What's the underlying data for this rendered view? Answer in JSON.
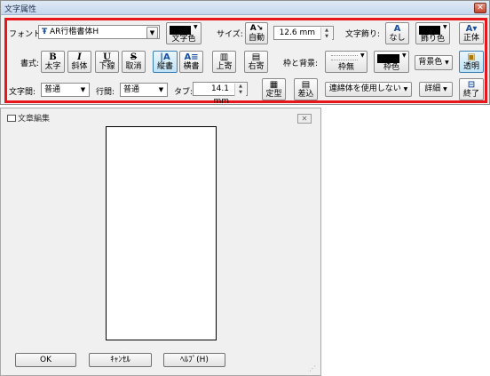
{
  "toolbar_window": {
    "title": "文字属性",
    "close": "✕",
    "font_label": "フォント:",
    "font_icon": "Ŧ",
    "font_value": "AR行楷書体H",
    "text_color_caption": "文字色",
    "size_label": "サイズ:",
    "size_auto_caption": "自動",
    "size_value": "12.6 mm",
    "decoration_label": "文字飾り:",
    "deco_none_caption": "なし",
    "deco_color_caption": "飾り色",
    "upright_caption": "正体",
    "style_label": "書式:",
    "bold": {
      "icon": "B",
      "caption": "太字"
    },
    "italic": {
      "icon": "I",
      "caption": "斜体"
    },
    "underline": {
      "icon": "U",
      "caption": "下線"
    },
    "strike": {
      "icon": "S",
      "caption": "取消"
    },
    "vertical": {
      "icon": "|A",
      "caption": "縦書"
    },
    "horizontal": {
      "icon": "A≡",
      "caption": "横書"
    },
    "align_top": {
      "icon": "▥",
      "caption": "上寄"
    },
    "align_right": {
      "icon": "▤",
      "caption": "右寄"
    },
    "frame_bg_label": "枠と背景:",
    "frame_none_caption": "枠無",
    "frame_color_caption": "枠色",
    "bg_color_label": "背景色",
    "transparent_caption": "透明",
    "char_spacing_label": "文字間:",
    "char_spacing_value": "普通",
    "line_spacing_label": "行間:",
    "line_spacing_value": "普通",
    "tab_label": "タブ:",
    "tab_value": "14.1 mm",
    "fixed_caption": "定型",
    "insert_caption": "差込",
    "connected_label": "連綿体を使用しない",
    "detail_label": "詳細",
    "exit_caption": "終了"
  },
  "edit_window": {
    "title": "文章編集",
    "close": "✕",
    "ok": "OK",
    "cancel": "ｷｬﾝｾﾙ",
    "help": "ﾍﾙﾌﾟ(H)"
  },
  "colors": {
    "highlight_border": "#e8151b",
    "swatch": "#000000",
    "window_bg": "#f0f0f0"
  }
}
